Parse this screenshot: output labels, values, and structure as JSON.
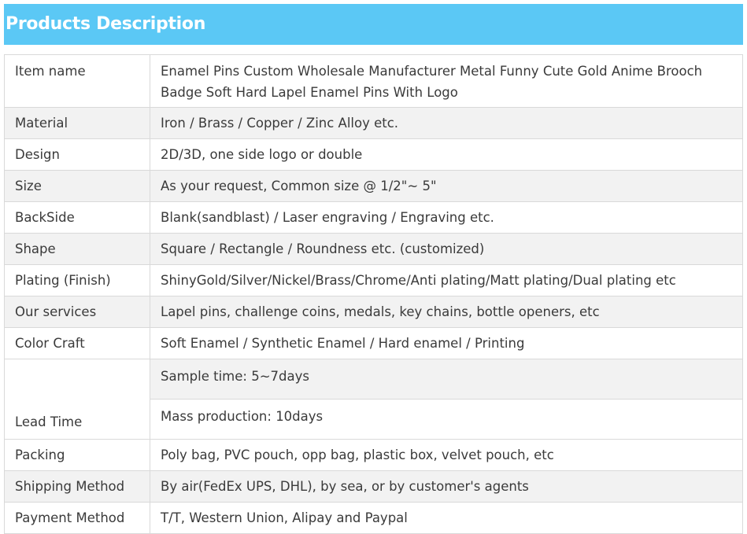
{
  "header": {
    "title": "Products Description"
  },
  "rows": [
    {
      "label": "Item name",
      "value": "Enamel Pins Custom Wholesale Manufacturer Metal Funny Cute Gold Anime Brooch Badge Soft Hard Lapel Enamel Pins With Logo"
    },
    {
      "label": "Material",
      "value": "Iron / Brass / Copper / Zinc Alloy etc."
    },
    {
      "label": "Design",
      "value": "2D/3D, one side logo or double"
    },
    {
      "label": "Size",
      "value": "As your request, Common size @ 1/2\"~ 5\""
    },
    {
      "label": "BackSide",
      "value": "Blank(sandblast) / Laser engraving / Engraving etc."
    },
    {
      "label": "Shape",
      "value": "Square / Rectangle / Roundness etc. (customized)"
    },
    {
      "label": "Plating (Finish)",
      "value": "ShinyGold/Silver/Nickel/Brass/Chrome/Anti plating/Matt plating/Dual plating etc"
    },
    {
      "label": "Our services",
      "value": "Lapel pins, challenge coins, medals, key chains, bottle openers, etc"
    },
    {
      "label": "Color Craft",
      "value": "Soft Enamel / Synthetic Enamel / Hard enamel / Printing"
    }
  ],
  "lead_time": {
    "label": "Lead Time",
    "sample": "Sample time: 5~7days",
    "mass": "Mass production: 10days"
  },
  "rows_after": [
    {
      "label": "Packing",
      "value": "Poly bag, PVC pouch, opp bag, plastic box, velvet pouch, etc"
    },
    {
      "label": "Shipping Method",
      "value": "By air(FedEx UPS, DHL), by sea, or by customer's agents"
    },
    {
      "label": "Payment Method",
      "value": "T/T, Western Union, Alipay and Paypal"
    }
  ]
}
